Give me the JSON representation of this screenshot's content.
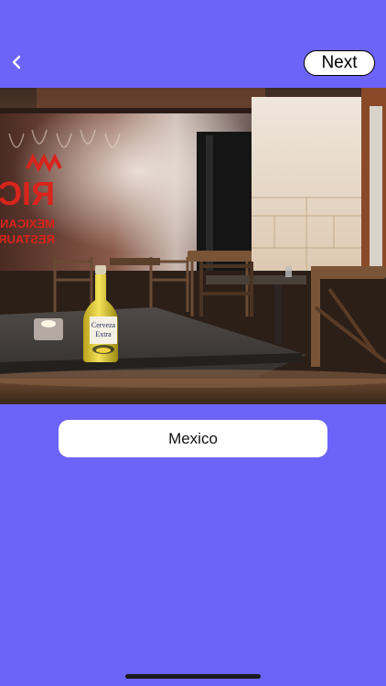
{
  "header": {
    "back_icon": "chevron-left-icon",
    "next_label": "Next"
  },
  "scene": {
    "description_icon": "restaurant-photo",
    "sign_brand": "RICO",
    "sign_line1": "MEXICAN",
    "sign_line2": "RESTAURANT",
    "bottle_label_line1": "Cerveza",
    "bottle_label_line2": "Extra"
  },
  "answer": {
    "label": "Mexico"
  },
  "colors": {
    "background": "#6C63F8",
    "button_bg": "#FFFFFF"
  }
}
